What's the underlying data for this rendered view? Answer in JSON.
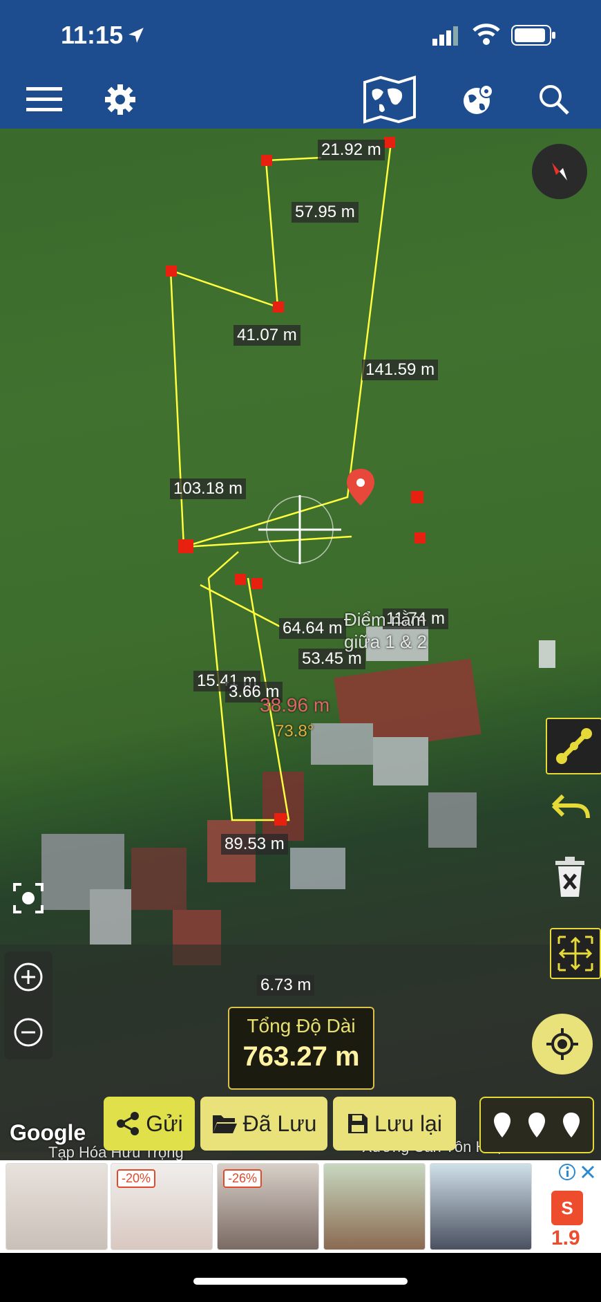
{
  "status": {
    "time": "11:15"
  },
  "toolbar": {
    "menu_icon": "hamburger-icon",
    "settings_icon": "gear-icon",
    "map_icon": "world-map-icon",
    "globe_icon": "globe-pin-icon",
    "search_icon": "search-icon"
  },
  "map": {
    "segment_labels": [
      "21.92 m",
      "57.95 m",
      "41.07 m",
      "141.59 m",
      "103.18 m",
      "64.64 m",
      "11.74 m",
      "53.45 m",
      "15.41 m",
      "3.66 m",
      "89.53 m",
      "6.73 m"
    ],
    "live_distance": "38.96 m",
    "live_angle": "73.8°",
    "pin_label": "Điểm nằm giữa 1 & 2",
    "place_left": "Tạp Hóa Hữu Trọng",
    "place_right": "Xưởng Cán Tôn Huệ An",
    "google": "Google"
  },
  "total": {
    "title": "Tổng Độ Dài",
    "value": "763.27 m"
  },
  "actions": {
    "send": "Gửi",
    "saved": "Đã Lưu",
    "save": "Lưu lại"
  },
  "ad": {
    "badge1": "-20%",
    "badge2": "-26%",
    "sale": "1.9"
  },
  "colors": {
    "header": "#1d4d8f",
    "line": "#ffff40",
    "vertex": "#e8200f",
    "button": "#e9e27a"
  }
}
